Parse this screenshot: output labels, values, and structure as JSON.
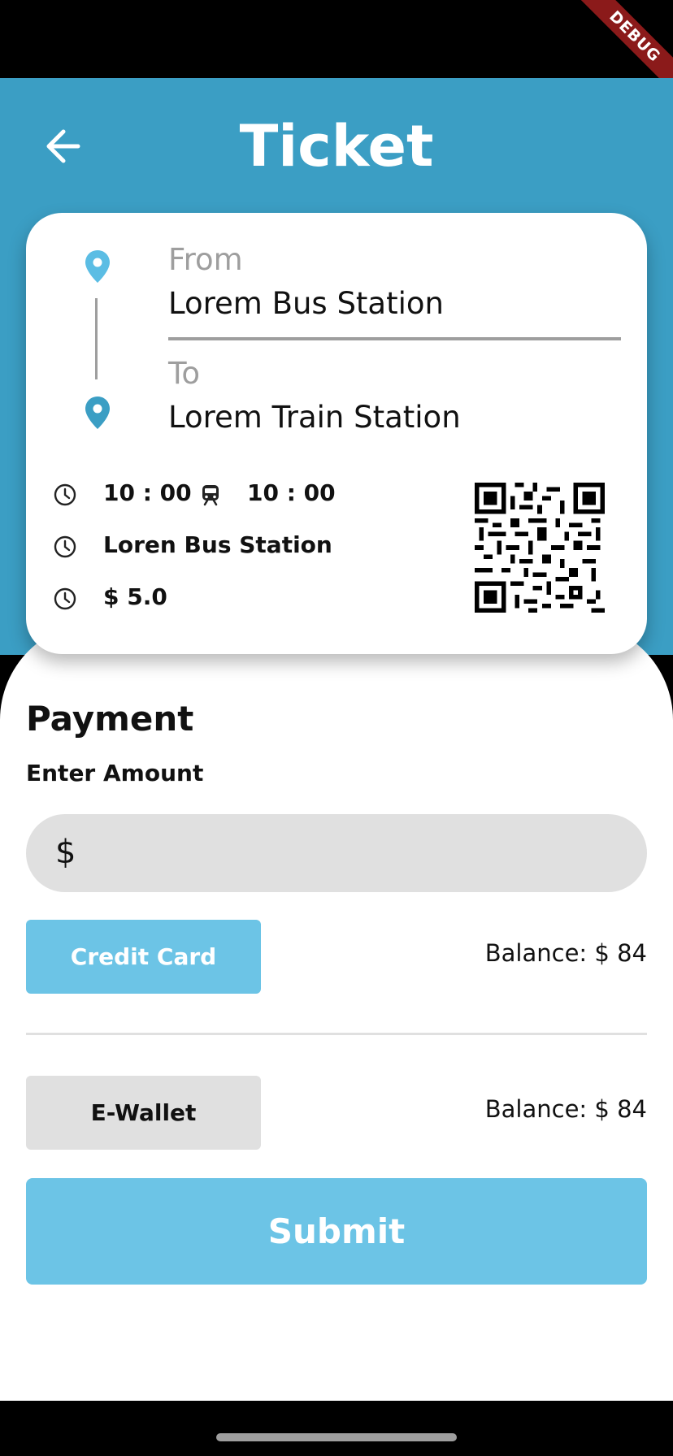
{
  "status_bar": {
    "debug_label": "DEBUG"
  },
  "header": {
    "title": "Ticket",
    "back_icon": "arrow-left-icon"
  },
  "ticket": {
    "from_label": "From",
    "from_station": "Lorem Bus Station",
    "to_label": "To",
    "to_station": "Lorem Train Station",
    "departure_time": "10 : 00",
    "arrival_time": "10 : 00",
    "station": "Loren Bus Station",
    "price": "$ 5.0",
    "icons": [
      "location-pin-icon",
      "clock-icon",
      "train-icon",
      "qr-code-icon"
    ]
  },
  "payment": {
    "title": "Payment",
    "enter_amount_label": "Enter Amount",
    "amount_prefix": "$",
    "amount_value": "",
    "methods": [
      {
        "label": "Credit Card",
        "balance": "Balance: $ 84",
        "selected": true
      },
      {
        "label": "E-Wallet",
        "balance": "Balance: $ 84",
        "selected": false
      }
    ],
    "submit_label": "Submit"
  },
  "colors": {
    "header_blue": "#3b9ec4",
    "accent_light_blue": "#6cc4e6",
    "field_grey": "#e0e0e0",
    "debug_red": "#8b1a1a"
  }
}
